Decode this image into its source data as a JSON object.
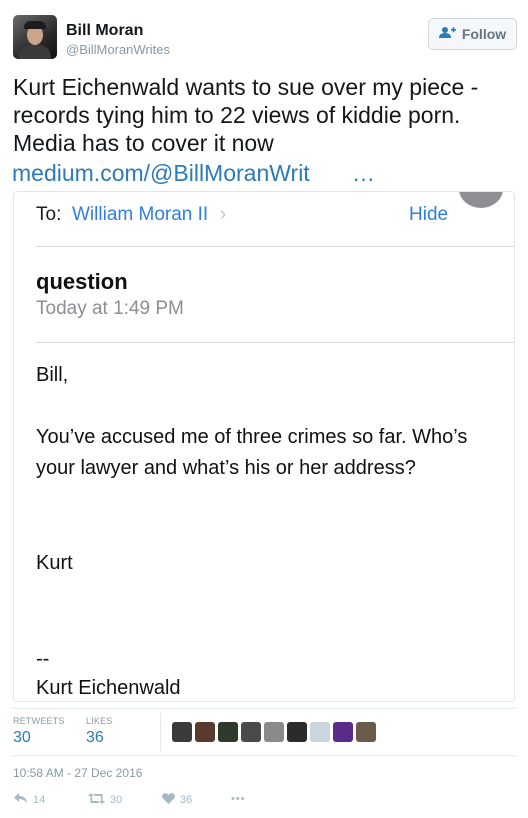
{
  "author": {
    "name": "Bill Moran",
    "handle": "@BillMoranWrites"
  },
  "follow_button": {
    "label": "Follow",
    "icon": "add-user-icon"
  },
  "tweet": {
    "text": "Kurt Eichenwald wants to sue over my piece - records tying him to 22 views of kiddie porn. Media has to cover it now",
    "link": "medium.com/@BillMoranWrit",
    "ellipsis": "…"
  },
  "email_card": {
    "to_label": "To:",
    "to_name": "William Moran II",
    "chevron": "›",
    "hide_label": "Hide",
    "subject": "question",
    "date": "Today at 1:49 PM",
    "greeting": "Bill,",
    "body": "You’ve accused me of three crimes so far. Who’s your lawyer and what’s his or her address?",
    "signoff": "Kurt",
    "sig_dashes": "--",
    "signature": "Kurt Eichenwald"
  },
  "stats": {
    "retweets_label": "RETWEETS",
    "retweets_count": "30",
    "likes_label": "LIKES",
    "likes_count": "36",
    "liker_avatar_colors": [
      "#3b3b3b",
      "#5a3a2e",
      "#2e3a2a",
      "#4a4a4a",
      "#8a8a8a",
      "#2b2b2b",
      "#c9d6e0",
      "#5b2b8a",
      "#6b5b4b"
    ]
  },
  "timestamp": "10:58 AM - 27 Dec 2016",
  "actions": {
    "reply_count": "14",
    "retweet_count": "30",
    "like_count": "36",
    "more": "•••"
  },
  "colors": {
    "link": "#2b7bb9",
    "mail_blue": "#2f7ee0",
    "muted": "#8899a6"
  }
}
